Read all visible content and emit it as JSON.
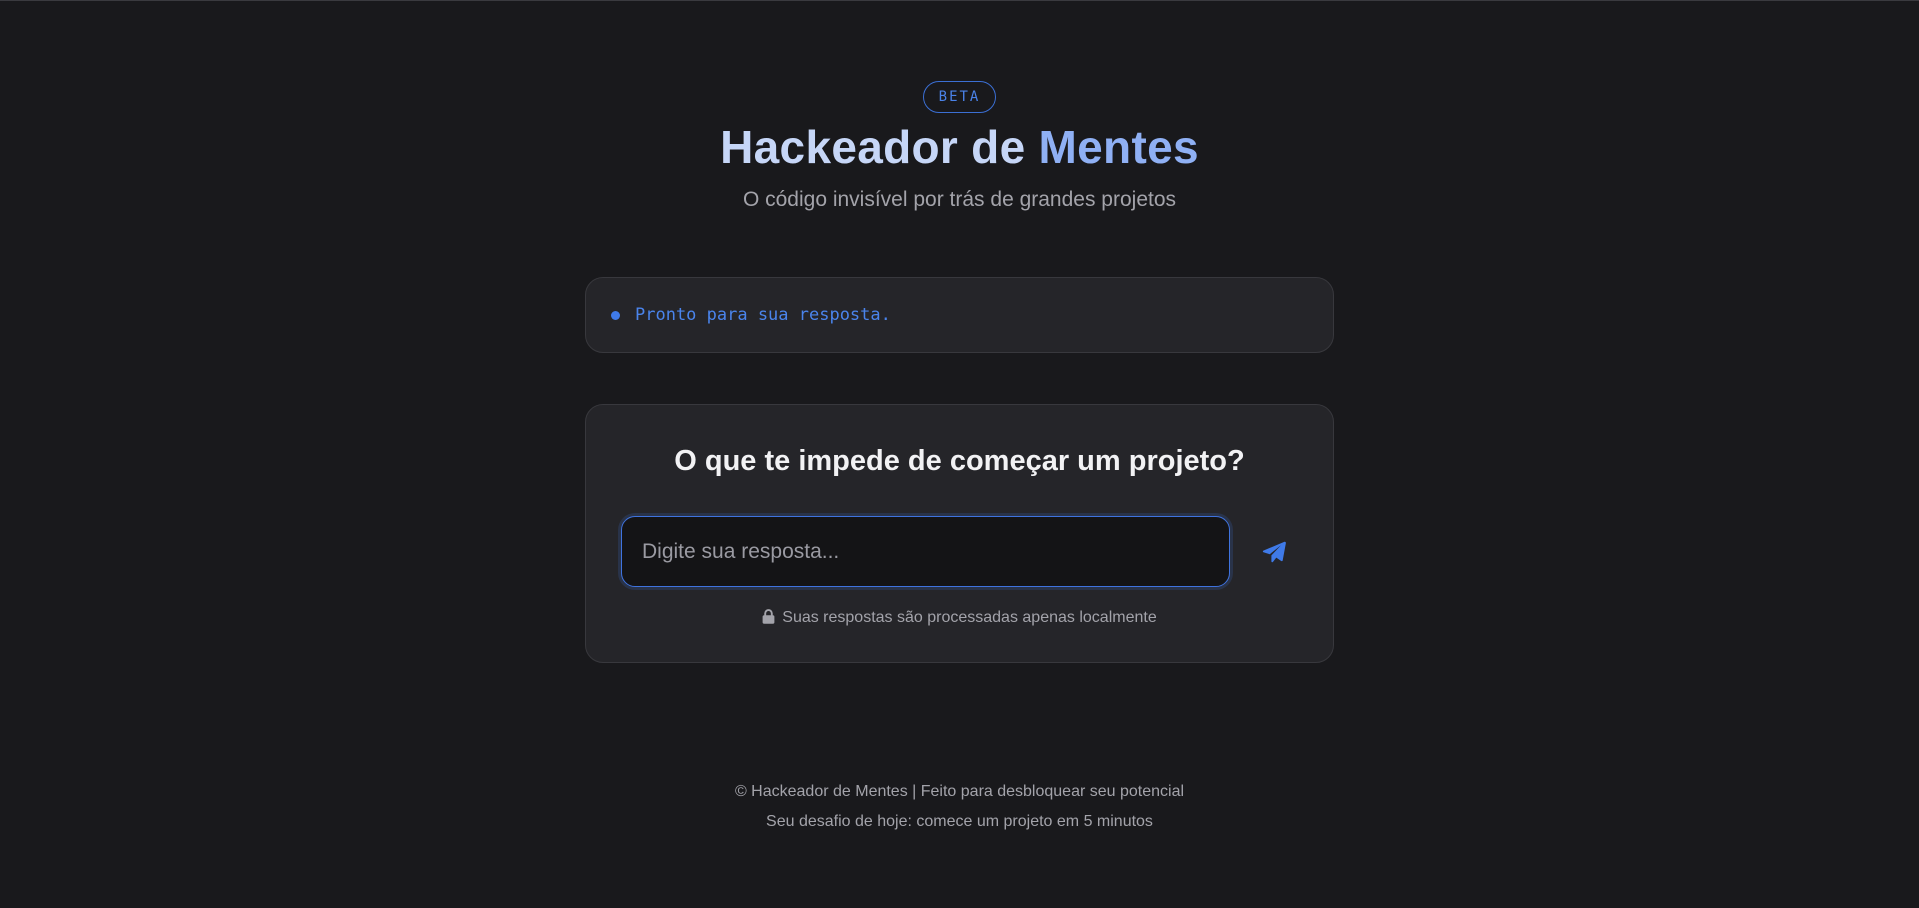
{
  "header": {
    "badge": "BETA",
    "title_part_1": "Hackeador de ",
    "title_part_2": "Mentes",
    "subtitle": "O código invisível por trás de grandes projetos"
  },
  "status": {
    "text": "Pronto para sua resposta."
  },
  "question": {
    "title": "O que te impede de começar um projeto?",
    "input_placeholder": "Digite sua resposta...",
    "input_value": "",
    "send_icon": "paper-plane-icon",
    "privacy_note": "Suas respostas são processadas apenas localmente",
    "privacy_icon": "lock-icon"
  },
  "footer": {
    "line1": "© Hackeador de Mentes | Feito para desbloquear seu potencial",
    "line2": "Seu desafio de hoje: comece um projeto em 5 minutos"
  },
  "colors": {
    "background": "#19191c",
    "card": "#252529",
    "accent": "#3f7ae8",
    "title_light": "#c6d6f7",
    "title_accent": "#8fb0f4"
  }
}
